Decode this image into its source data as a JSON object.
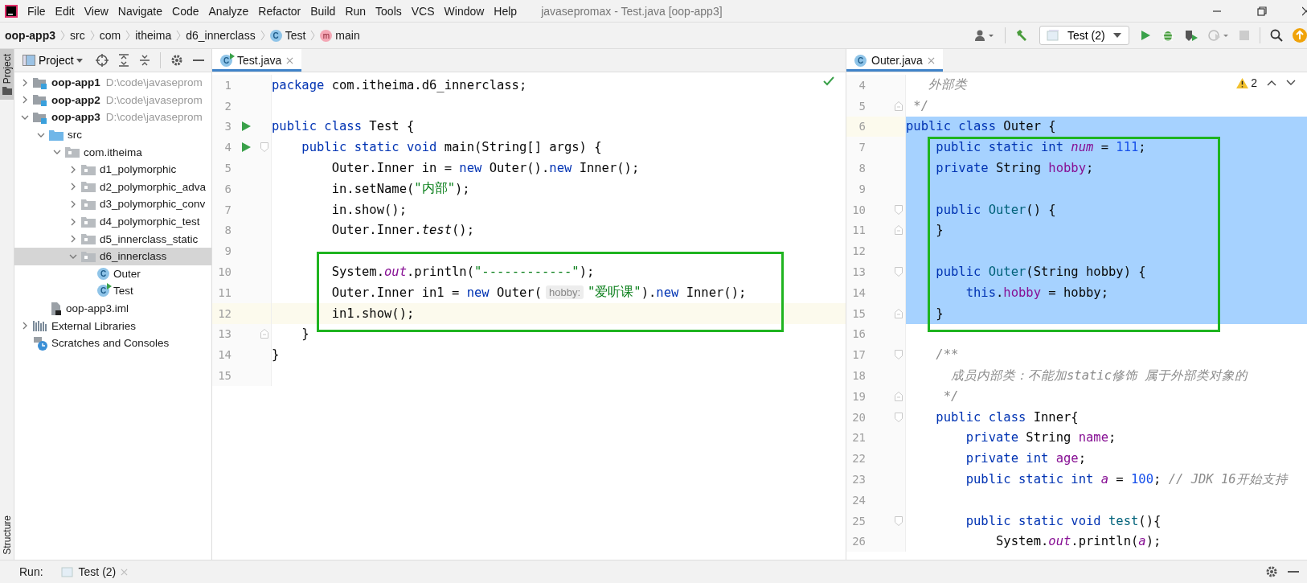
{
  "window": {
    "title": "javasepromax - Test.java [oop-app3]"
  },
  "menu": [
    "File",
    "Edit",
    "View",
    "Navigate",
    "Code",
    "Analyze",
    "Refactor",
    "Build",
    "Run",
    "Tools",
    "VCS",
    "Window",
    "Help"
  ],
  "breadcrumb": [
    {
      "kind": "module",
      "text": "oop-app3"
    },
    {
      "kind": "folder",
      "text": "src"
    },
    {
      "kind": "folder",
      "text": "com"
    },
    {
      "kind": "folder",
      "text": "itheima"
    },
    {
      "kind": "folder",
      "text": "d6_innerclass"
    },
    {
      "kind": "class",
      "icon_text": "C",
      "text": "Test"
    },
    {
      "kind": "method",
      "icon_text": "m",
      "text": "main"
    }
  ],
  "toolbar": {
    "run_config": "Test (2)"
  },
  "side_tabs": [
    {
      "label": "Project",
      "selected": true
    },
    {
      "label": "Structure",
      "selected": false
    }
  ],
  "project": {
    "title": "Project",
    "tree": [
      {
        "kind": "module",
        "name": "oop-app1",
        "path": "D:\\code\\javaseprom",
        "expanded": false,
        "selected": false
      },
      {
        "kind": "module",
        "name": "oop-app2",
        "path": "D:\\code\\javaseprom",
        "expanded": false,
        "selected": false
      },
      {
        "kind": "module",
        "name": "oop-app3",
        "path": "D:\\code\\javaseprom",
        "expanded": true,
        "selected": false,
        "children": [
          {
            "kind": "source",
            "name": "src",
            "expanded": true,
            "selected": false,
            "children": [
              {
                "kind": "package",
                "name": "com.itheima",
                "expanded": true,
                "selected": false,
                "children": [
                  {
                    "kind": "package",
                    "name": "d1_polymorphic",
                    "expanded": false,
                    "selected": false
                  },
                  {
                    "kind": "package",
                    "name": "d2_polymorphic_adva",
                    "expanded": false,
                    "selected": false
                  },
                  {
                    "kind": "package",
                    "name": "d3_polymorphic_conv",
                    "expanded": false,
                    "selected": false
                  },
                  {
                    "kind": "package",
                    "name": "d4_polymorphic_test",
                    "expanded": false,
                    "selected": false
                  },
                  {
                    "kind": "package",
                    "name": "d5_innerclass_static",
                    "expanded": false,
                    "selected": false
                  },
                  {
                    "kind": "package",
                    "name": "d6_innerclass",
                    "expanded": true,
                    "selected": true,
                    "children": [
                      {
                        "kind": "class",
                        "icon_text": "C",
                        "name": "Outer",
                        "selected": false
                      },
                      {
                        "kind": "runnable-class",
                        "icon_text": "C",
                        "name": "Test",
                        "selected": false
                      }
                    ]
                  }
                ]
              }
            ]
          },
          {
            "kind": "file",
            "name": "oop-app3.iml",
            "selected": false
          }
        ]
      },
      {
        "kind": "libraries",
        "name": "External Libraries",
        "expanded": false,
        "selected": false
      },
      {
        "kind": "scratches",
        "name": "Scratches and Consoles",
        "selected": false
      }
    ]
  },
  "editors": [
    {
      "tab": {
        "label": "Test.java",
        "icon_text": "C",
        "runnable": true,
        "selected": true
      },
      "inspection": {
        "kind": "ok"
      },
      "lines": [
        {
          "number": "1",
          "current": false,
          "selected": false,
          "boxed": false,
          "tokens": [
            {
              "kind": "keyword",
              "text": "package"
            },
            {
              "kind": "plain",
              "text": " com.itheima.d6_innerclass;"
            }
          ]
        },
        {
          "number": "2",
          "current": false,
          "selected": false,
          "boxed": false
        },
        {
          "number": "3",
          "current": false,
          "selected": false,
          "boxed": false,
          "markers": [
            {
              "kind": "run"
            }
          ],
          "tokens": [
            {
              "kind": "keyword",
              "text": "public class"
            },
            {
              "kind": "plain",
              "text": " Test {"
            }
          ]
        },
        {
          "number": "4",
          "current": false,
          "selected": false,
          "boxed": false,
          "markers": [
            {
              "kind": "run"
            },
            {
              "kind": "fold-start"
            }
          ],
          "tokens": [
            {
              "kind": "keyword",
              "text": "    public static void"
            },
            {
              "kind": "plain",
              "text": " main(String[] args) {"
            }
          ]
        },
        {
          "number": "5",
          "current": false,
          "selected": false,
          "boxed": false,
          "tokens": [
            {
              "kind": "plain",
              "text": "        Outer.Inner in = "
            },
            {
              "kind": "keyword",
              "text": "new"
            },
            {
              "kind": "plain",
              "text": " Outer()."
            },
            {
              "kind": "keyword",
              "text": "new"
            },
            {
              "kind": "plain",
              "text": " Inner();"
            }
          ]
        },
        {
          "number": "6",
          "current": false,
          "selected": false,
          "boxed": false,
          "tokens": [
            {
              "kind": "plain",
              "text": "        in.setName("
            },
            {
              "kind": "string",
              "text": "\"内部\""
            },
            {
              "kind": "plain",
              "text": ");"
            }
          ]
        },
        {
          "number": "7",
          "current": false,
          "selected": false,
          "boxed": false,
          "tokens": [
            {
              "kind": "plain",
              "text": "        in.show();"
            }
          ]
        },
        {
          "number": "8",
          "current": false,
          "selected": false,
          "boxed": false,
          "tokens": [
            {
              "kind": "plain",
              "text": "        Outer.Inner."
            },
            {
              "kind": "static-call",
              "text": "test"
            },
            {
              "kind": "plain",
              "text": "();"
            }
          ]
        },
        {
          "number": "9",
          "current": false,
          "selected": false,
          "boxed": false
        },
        {
          "number": "10",
          "current": false,
          "selected": false,
          "boxed": true,
          "tokens": [
            {
              "kind": "plain",
              "text": "        System."
            },
            {
              "kind": "static-field",
              "text": "out"
            },
            {
              "kind": "plain",
              "text": ".println("
            },
            {
              "kind": "string",
              "text": "\"------------\""
            },
            {
              "kind": "plain",
              "text": ");"
            }
          ]
        },
        {
          "number": "11",
          "current": false,
          "selected": false,
          "boxed": true,
          "tokens": [
            {
              "kind": "plain",
              "text": "        Outer.Inner in1 = "
            },
            {
              "kind": "keyword",
              "text": "new"
            },
            {
              "kind": "plain",
              "text": " Outer("
            },
            {
              "kind": "hint",
              "text": "hobby:"
            },
            {
              "kind": "string",
              "text": "\"爱听课\""
            },
            {
              "kind": "plain",
              "text": ")."
            },
            {
              "kind": "keyword",
              "text": "new"
            },
            {
              "kind": "plain",
              "text": " Inner();"
            }
          ]
        },
        {
          "number": "12",
          "current": true,
          "selected": false,
          "boxed": true,
          "tokens": [
            {
              "kind": "plain",
              "text": "        in1.show();"
            }
          ]
        },
        {
          "number": "13",
          "current": false,
          "selected": false,
          "boxed": false,
          "markers": [
            {
              "kind": "fold-end"
            }
          ],
          "tokens": [
            {
              "kind": "plain",
              "text": "    }"
            }
          ]
        },
        {
          "number": "14",
          "current": false,
          "selected": false,
          "boxed": false,
          "tokens": [
            {
              "kind": "plain",
              "text": "}"
            }
          ]
        },
        {
          "number": "15",
          "current": false,
          "selected": false,
          "boxed": false
        }
      ]
    },
    {
      "tab": {
        "label": "Outer.java",
        "icon_text": "C",
        "runnable": false,
        "selected": true
      },
      "inspection": {
        "kind": "warning",
        "count": "2"
      },
      "lines": [
        {
          "number": "4",
          "current": false,
          "selected": false,
          "boxed": false,
          "tokens": [
            {
              "kind": "comment",
              "text": "   外部类"
            }
          ]
        },
        {
          "number": "5",
          "current": false,
          "selected": false,
          "boxed": false,
          "markers": [
            {
              "kind": "fold-end"
            }
          ],
          "tokens": [
            {
              "kind": "comment",
              "text": " */"
            }
          ]
        },
        {
          "number": "6",
          "current": true,
          "selected": true,
          "boxed": false,
          "tokens": [
            {
              "kind": "keyword",
              "text": "public class"
            },
            {
              "kind": "plain",
              "text": " Outer {"
            }
          ]
        },
        {
          "number": "7",
          "current": false,
          "selected": true,
          "boxed": true,
          "tokens": [
            {
              "kind": "keyword",
              "text": "    public static int "
            },
            {
              "kind": "static-field",
              "text": "num"
            },
            {
              "kind": "plain",
              "text": " = "
            },
            {
              "kind": "number",
              "text": "111"
            },
            {
              "kind": "plain",
              "text": ";"
            }
          ]
        },
        {
          "number": "8",
          "current": false,
          "selected": true,
          "boxed": true,
          "tokens": [
            {
              "kind": "keyword",
              "text": "    private"
            },
            {
              "kind": "plain",
              "text": " String "
            },
            {
              "kind": "field",
              "text": "hobby"
            },
            {
              "kind": "plain",
              "text": ";"
            }
          ]
        },
        {
          "number": "9",
          "current": false,
          "selected": true,
          "boxed": true
        },
        {
          "number": "10",
          "current": false,
          "selected": true,
          "boxed": true,
          "markers": [
            {
              "kind": "fold-start"
            }
          ],
          "tokens": [
            {
              "kind": "keyword",
              "text": "    public "
            },
            {
              "kind": "declaration",
              "text": "Outer"
            },
            {
              "kind": "plain",
              "text": "() {"
            }
          ]
        },
        {
          "number": "11",
          "current": false,
          "selected": true,
          "boxed": true,
          "markers": [
            {
              "kind": "fold-end"
            }
          ],
          "tokens": [
            {
              "kind": "plain",
              "text": "    }"
            }
          ]
        },
        {
          "number": "12",
          "current": false,
          "selected": true,
          "boxed": true
        },
        {
          "number": "13",
          "current": false,
          "selected": true,
          "boxed": true,
          "markers": [
            {
              "kind": "fold-start"
            }
          ],
          "tokens": [
            {
              "kind": "keyword",
              "text": "    public "
            },
            {
              "kind": "declaration",
              "text": "Outer"
            },
            {
              "kind": "plain",
              "text": "(String hobby) {"
            }
          ]
        },
        {
          "number": "14",
          "current": false,
          "selected": true,
          "boxed": true,
          "tokens": [
            {
              "kind": "keyword",
              "text": "        this"
            },
            {
              "kind": "plain",
              "text": "."
            },
            {
              "kind": "field",
              "text": "hobby"
            },
            {
              "kind": "plain",
              "text": " = hobby;"
            }
          ]
        },
        {
          "number": "15",
          "current": false,
          "selected": true,
          "boxed": true,
          "markers": [
            {
              "kind": "fold-end"
            }
          ],
          "tokens": [
            {
              "kind": "plain",
              "text": "    }"
            }
          ]
        },
        {
          "number": "16",
          "current": false,
          "selected": false,
          "boxed": false
        },
        {
          "number": "17",
          "current": false,
          "selected": false,
          "boxed": false,
          "markers": [
            {
              "kind": "fold-start"
            }
          ],
          "tokens": [
            {
              "kind": "comment",
              "text": "    /**"
            }
          ]
        },
        {
          "number": "18",
          "current": false,
          "selected": false,
          "boxed": false,
          "tokens": [
            {
              "kind": "comment",
              "text": "      成员内部类：不能加static修饰 属于外部类对象的"
            }
          ]
        },
        {
          "number": "19",
          "current": false,
          "selected": false,
          "boxed": false,
          "markers": [
            {
              "kind": "fold-end"
            }
          ],
          "tokens": [
            {
              "kind": "comment",
              "text": "     */"
            }
          ]
        },
        {
          "number": "20",
          "current": false,
          "selected": false,
          "boxed": false,
          "markers": [
            {
              "kind": "fold-start"
            }
          ],
          "tokens": [
            {
              "kind": "keyword",
              "text": "    public class"
            },
            {
              "kind": "plain",
              "text": " Inner{"
            }
          ]
        },
        {
          "number": "21",
          "current": false,
          "selected": false,
          "boxed": false,
          "tokens": [
            {
              "kind": "keyword",
              "text": "        private"
            },
            {
              "kind": "plain",
              "text": " String "
            },
            {
              "kind": "field",
              "text": "name"
            },
            {
              "kind": "plain",
              "text": ";"
            }
          ]
        },
        {
          "number": "22",
          "current": false,
          "selected": false,
          "boxed": false,
          "tokens": [
            {
              "kind": "keyword",
              "text": "        private int "
            },
            {
              "kind": "field",
              "text": "age"
            },
            {
              "kind": "plain",
              "text": ";"
            }
          ]
        },
        {
          "number": "23",
          "current": false,
          "selected": false,
          "boxed": false,
          "tokens": [
            {
              "kind": "keyword",
              "text": "        public static int "
            },
            {
              "kind": "static-field",
              "text": "a"
            },
            {
              "kind": "plain",
              "text": " = "
            },
            {
              "kind": "number",
              "text": "100"
            },
            {
              "kind": "plain",
              "text": "; "
            },
            {
              "kind": "comment",
              "text": "// JDK 16开始支持"
            }
          ]
        },
        {
          "number": "24",
          "current": false,
          "selected": false,
          "boxed": false
        },
        {
          "number": "25",
          "current": false,
          "selected": false,
          "boxed": false,
          "markers": [
            {
              "kind": "fold-start"
            }
          ],
          "tokens": [
            {
              "kind": "keyword",
              "text": "        public static void "
            },
            {
              "kind": "declaration",
              "text": "test"
            },
            {
              "kind": "plain",
              "text": "(){"
            }
          ]
        },
        {
          "number": "26",
          "current": false,
          "selected": false,
          "boxed": false,
          "tokens": [
            {
              "kind": "plain",
              "text": "            System."
            },
            {
              "kind": "static-field",
              "text": "out"
            },
            {
              "kind": "plain",
              "text": ".println("
            },
            {
              "kind": "static-field",
              "text": "a"
            },
            {
              "kind": "plain",
              "text": ");"
            }
          ]
        }
      ]
    }
  ],
  "run_bar": {
    "label": "Run:",
    "tab": "Test (2)"
  }
}
